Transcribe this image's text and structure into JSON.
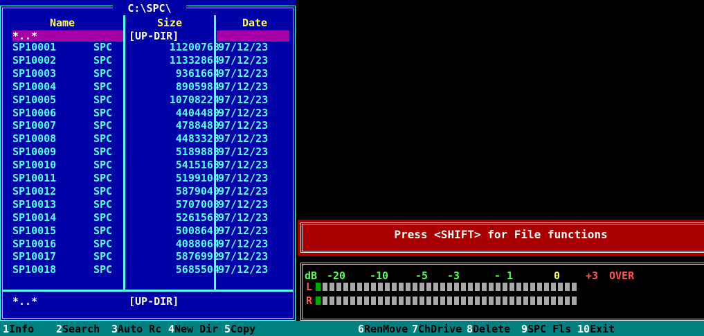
{
  "panel": {
    "path": "C:\\SPC\\",
    "headers": {
      "name": "Name",
      "size": "Size",
      "date": "Date"
    },
    "updir": {
      "name": "*..*",
      "size": "[UP-DIR]"
    },
    "files": [
      {
        "name": "SP10001",
        "ext": "SPC",
        "size": "11200768",
        "date": "97/12/23"
      },
      {
        "name": "SP10002",
        "ext": "SPC",
        "size": "11332864",
        "date": "97/12/23"
      },
      {
        "name": "SP10003",
        "ext": "SPC",
        "size": "9361664",
        "date": "97/12/23"
      },
      {
        "name": "SP10004",
        "ext": "SPC",
        "size": "8905984",
        "date": "97/12/23"
      },
      {
        "name": "SP10005",
        "ext": "SPC",
        "size": "10708224",
        "date": "97/12/23"
      },
      {
        "name": "SP10006",
        "ext": "SPC",
        "size": "4404480",
        "date": "97/12/23"
      },
      {
        "name": "SP10007",
        "ext": "SPC",
        "size": "4788480",
        "date": "97/12/23"
      },
      {
        "name": "SP10008",
        "ext": "SPC",
        "size": "4483328",
        "date": "97/12/23"
      },
      {
        "name": "SP10009",
        "ext": "SPC",
        "size": "5189888",
        "date": "97/12/23"
      },
      {
        "name": "SP10010",
        "ext": "SPC",
        "size": "5415168",
        "date": "97/12/23"
      },
      {
        "name": "SP10011",
        "ext": "SPC",
        "size": "5199104",
        "date": "97/12/23"
      },
      {
        "name": "SP10012",
        "ext": "SPC",
        "size": "5879040",
        "date": "97/12/23"
      },
      {
        "name": "SP10013",
        "ext": "SPC",
        "size": "5707008",
        "date": "97/12/23"
      },
      {
        "name": "SP10014",
        "ext": "SPC",
        "size": "5261568",
        "date": "97/12/23"
      },
      {
        "name": "SP10015",
        "ext": "SPC",
        "size": "5008640",
        "date": "97/12/23"
      },
      {
        "name": "SP10016",
        "ext": "SPC",
        "size": "4088064",
        "date": "97/12/23"
      },
      {
        "name": "SP10017",
        "ext": "SPC",
        "size": "5876992",
        "date": "97/12/23"
      },
      {
        "name": "SP10018",
        "ext": "SPC",
        "size": "5685504",
        "date": "97/12/23"
      }
    ],
    "footer": {
      "name": "*..*",
      "size": "[UP-DIR]"
    }
  },
  "message": "Press <SHIFT> for File functions",
  "vu": {
    "db_prefix": "dB",
    "scale": [
      {
        "label": "-20",
        "color": "#55ff55"
      },
      {
        "label": "-10",
        "color": "#55ff55"
      },
      {
        "label": "-5",
        "color": "#55ff55"
      },
      {
        "label": "-3",
        "color": "#55ff55"
      },
      {
        "label": "- 1",
        "color": "#55ff55"
      },
      {
        "label": "0",
        "color": "#ffff55"
      },
      {
        "label": "+3",
        "color": "#ff5555"
      },
      {
        "label": "OVER",
        "color": "#ff5555"
      }
    ],
    "left_label": "L",
    "right_label": "R",
    "segments": 38,
    "left_level_segments": 1,
    "right_level_segments": 1
  },
  "fkeys": [
    {
      "num": "1",
      "label": "Info"
    },
    {
      "num": "2",
      "label": "Search"
    },
    {
      "num": "3",
      "label": "Auto Rc"
    },
    {
      "num": "4",
      "label": "New Dir"
    },
    {
      "num": "5",
      "label": "Copy"
    },
    {
      "num": "6",
      "label": "RenMove"
    },
    {
      "num": "7",
      "label": "ChDrive"
    },
    {
      "num": "8",
      "label": "Delete"
    },
    {
      "num": "9",
      "label": "SPC Fls"
    },
    {
      "num": "10",
      "label": "Exit"
    }
  ],
  "colors": {
    "panel_bg": "#0000a8",
    "border": "#55ffff",
    "highlight": "#a800a8",
    "fkey_bg": "#008080",
    "msg_bg": "#a80000"
  }
}
